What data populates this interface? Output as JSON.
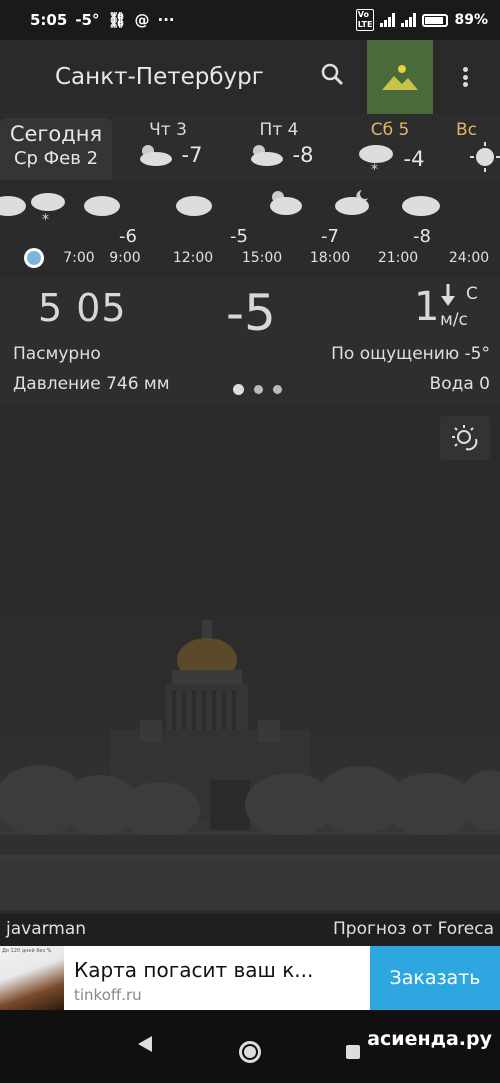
{
  "status_bar": {
    "time": "5:05",
    "temp": "-5°",
    "battery": "89%",
    "network": "4G"
  },
  "header": {
    "city": "Санкт-Петербург"
  },
  "days": {
    "today_label": "Сегодня",
    "today_date": "Ср Фев 2",
    "items": [
      {
        "label": "Чт 3",
        "temp": "-7",
        "icon": "cloud-sun-icon"
      },
      {
        "label": "Пт 4",
        "temp": "-8",
        "icon": "cloud-sun-icon"
      },
      {
        "label": "Сб 5",
        "temp": "-4",
        "icon": "snow-cloud-icon"
      },
      {
        "label": "Вс",
        "temp": "",
        "icon": "sun-icon"
      }
    ]
  },
  "hourly": {
    "temps": [
      "-6",
      "-5",
      "-7",
      "-8"
    ],
    "times": [
      "7:00",
      "9:00",
      "12:00",
      "15:00",
      "18:00",
      "21:00",
      "24:00"
    ]
  },
  "current": {
    "time": "5 05",
    "temp": "-5",
    "wind_speed": "1",
    "wind_dir": "С",
    "wind_unit": "м/с",
    "condition": "Пасмурно",
    "feels_like": "По ощущению -5°",
    "pressure": "Давление 746 мм",
    "water": "Вода 0"
  },
  "credits": {
    "author": "javarman",
    "provider": "Прогноз от Foreca"
  },
  "ad": {
    "title": "Карта погасит ваш к...",
    "url": "tinkoff.ru",
    "button": "Заказать",
    "thumb_text": "До 120 дней без %"
  },
  "watermark": "асиенда.ру",
  "colors": {
    "accent_green": "#4a6a3a",
    "ad_button": "#2ea7e0",
    "saturday": "#d9b86a"
  }
}
